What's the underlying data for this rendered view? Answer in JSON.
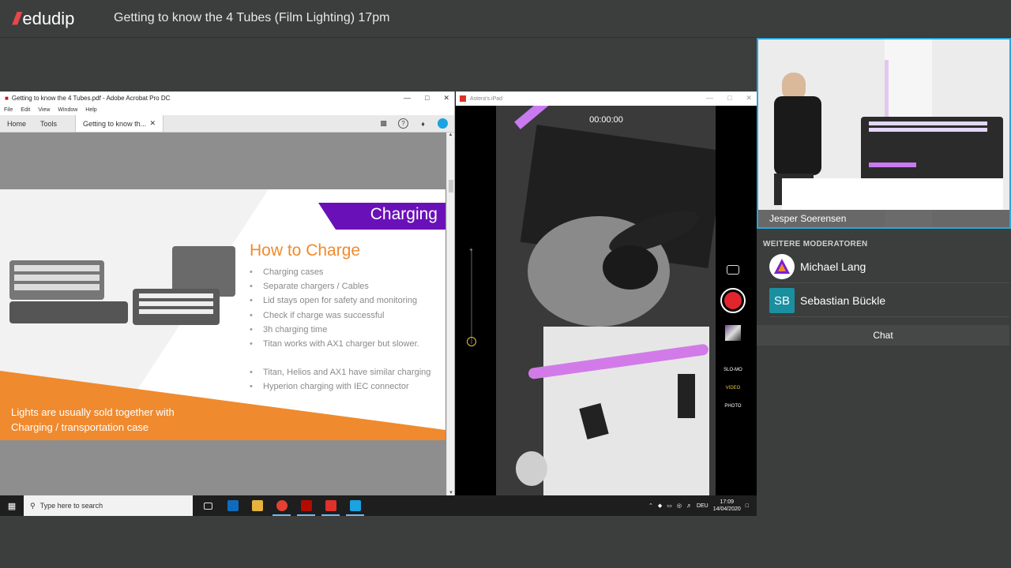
{
  "app": {
    "logo": "edudip",
    "session_title": "Getting to know the 4 Tubes (Film Lighting) 17pm"
  },
  "acrobat": {
    "window_title": "Getting to know the 4 Tubes.pdf - Adobe Acrobat Pro DC",
    "menu": [
      "File",
      "Edit",
      "View",
      "Window",
      "Help"
    ],
    "tabs": {
      "home": "Home",
      "tools": "Tools",
      "doc": "Getting to know th..."
    },
    "slide": {
      "header": "Charging",
      "title": "How to Charge",
      "bullets": [
        "Charging cases",
        "Separate chargers / Cables",
        "Lid stays open for safety and monitoring",
        "Check if charge was successful",
        "3h charging time",
        "Titan works with AX1 charger but slower.",
        "",
        "Titan, Helios and AX1 have similar charging",
        "Hyperion charging with IEC connector"
      ],
      "footer_line1": "Lights are usually sold together with",
      "footer_line2": "Charging / transportation case",
      "colors": {
        "accent_purple": "#6a10b8",
        "accent_orange": "#f08a2e"
      }
    }
  },
  "ipad": {
    "window_title": "Astera's iPad",
    "timer": "00:00:00",
    "modes": [
      "SLO-MO",
      "VIDEO",
      "PHOTO"
    ],
    "active_mode": "VIDEO"
  },
  "taskbar": {
    "search_placeholder": "Type here to search",
    "lang": "DEU",
    "time": "17:09",
    "date": "14/04/2020"
  },
  "presenter": {
    "name": "Jesper Soerensen"
  },
  "sidebar": {
    "heading": "WEITERE MODERATOREN",
    "moderators": [
      {
        "name": "Michael Lang",
        "initials": ""
      },
      {
        "name": "Sebastian Bückle",
        "initials": "SB"
      }
    ],
    "chat_label": "Chat"
  },
  "colors": {
    "highlight": "#2aa6d9",
    "brand_red": "#e5484d"
  }
}
